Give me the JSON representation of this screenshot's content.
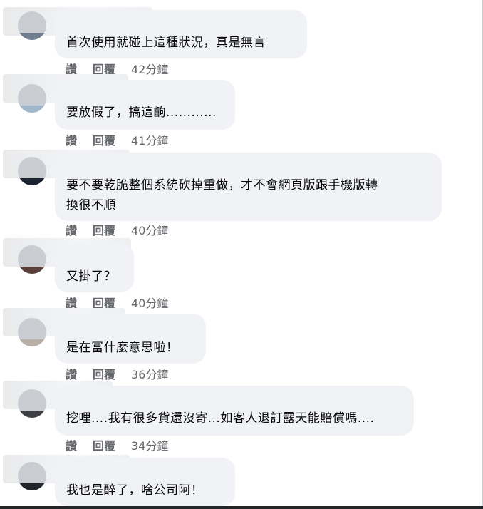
{
  "actions": {
    "like": "讚",
    "reply": "回覆"
  },
  "comments": [
    {
      "text": "首次使用就碰上這種狀況，真是無言",
      "time": "42分鐘"
    },
    {
      "text": "要放假了，搞這齣............",
      "time": "41分鐘"
    },
    {
      "text": "要不要乾脆整個系統砍掉重做，才不會網頁版跟手機版轉\n換很不順",
      "time": "40分鐘"
    },
    {
      "text": "又掛了？",
      "time": "40分鐘"
    },
    {
      "text": "是在冨什麼意思啦！",
      "time": "36分鐘"
    },
    {
      "text": "挖哩....我有很多貨還沒寄...如客人退訂露天能賠償嗎....",
      "time": "34分鐘"
    },
    {
      "text": "我也是醉了，啥公司阿！",
      "time": ""
    }
  ],
  "colors": {
    "bubble": "#f0f2f5",
    "meta": "#65676b",
    "text": "#050505"
  }
}
